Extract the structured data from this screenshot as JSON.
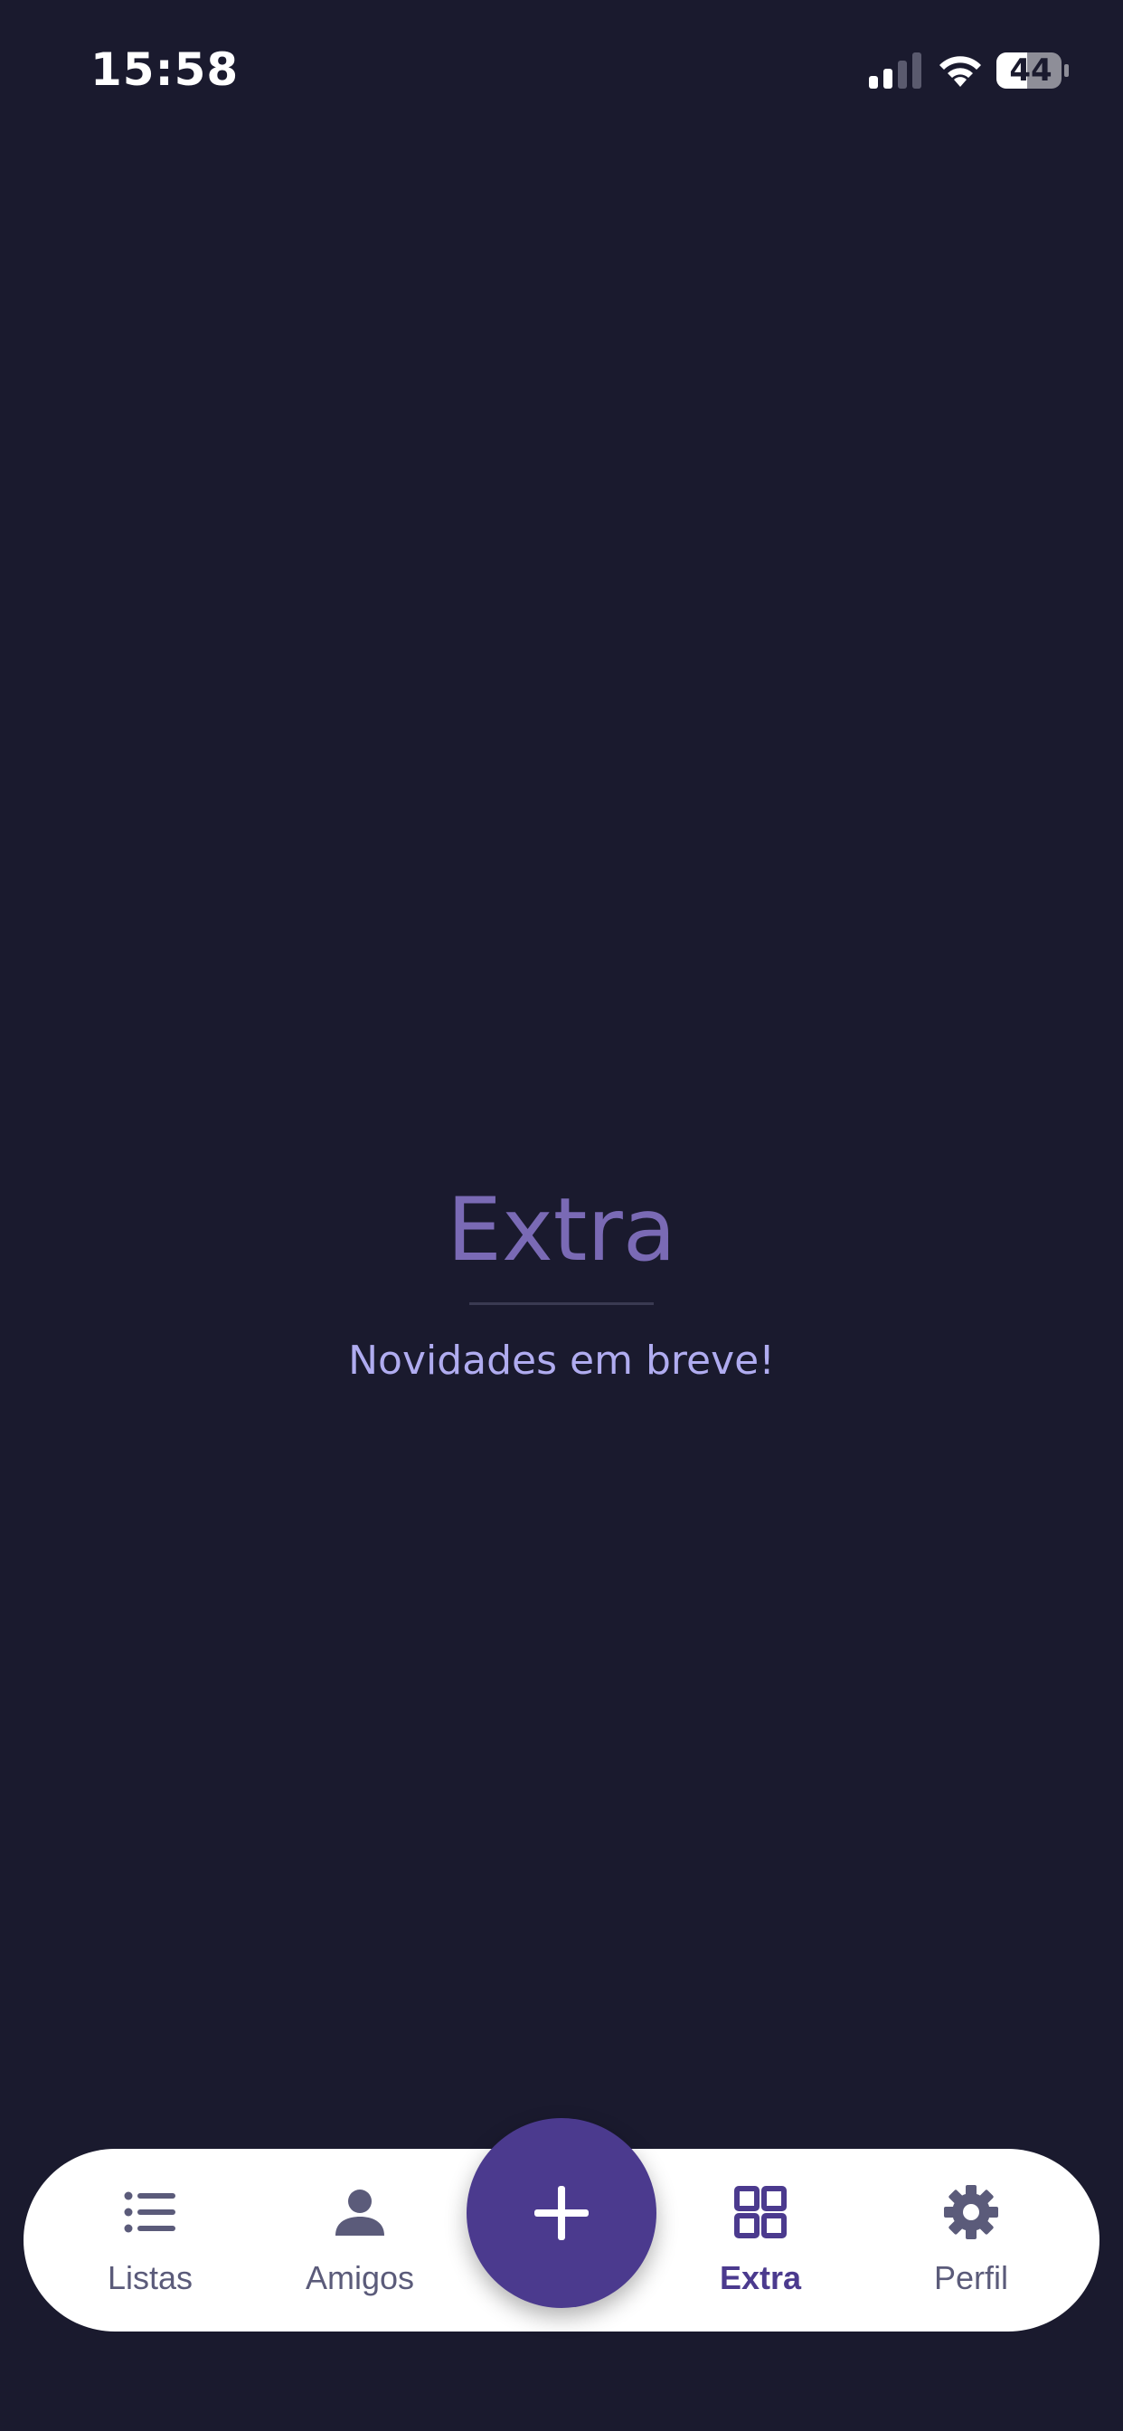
{
  "status_bar": {
    "time": "15:58",
    "battery_level": "44",
    "signal_icon": "cellular-signal-icon",
    "wifi_icon": "wifi-icon",
    "battery_icon": "battery-icon"
  },
  "main": {
    "title": "Extra",
    "subtitle": "Novidades em breve!"
  },
  "tabbar": {
    "items": [
      {
        "label": "Listas",
        "icon": "list-icon",
        "active": false
      },
      {
        "label": "Amigos",
        "icon": "person-icon",
        "active": false
      },
      {
        "label": "Extra",
        "icon": "grid-icon",
        "active": true
      },
      {
        "label": "Perfil",
        "icon": "gear-icon",
        "active": false
      }
    ],
    "fab_icon": "plus-icon"
  },
  "colors": {
    "background": "#1a1a2e",
    "accent": "#4b3a8e",
    "title": "#7a6ab5",
    "subtitle": "#b0acf0",
    "tab_inactive": "#5b5b7a",
    "tabbar_background": "#ffffff"
  }
}
